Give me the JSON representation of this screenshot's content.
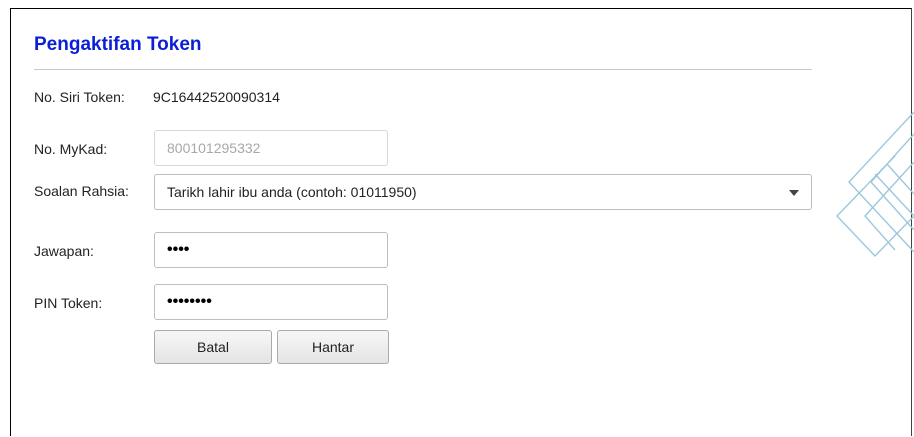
{
  "form": {
    "title": "Pengaktifan Token",
    "serial_label": "No. Siri Token:",
    "serial_value": "9C16442520090314",
    "mykad_label": "No. MyKad:",
    "mykad_value": "800101295332",
    "question_label": "Soalan Rahsia:",
    "question_value": "Tarikh lahir ibu anda (contoh: 01011950)",
    "answer_label": "Jawapan:",
    "answer_value": "••••",
    "pin_label": "PIN Token:",
    "pin_value": "••••••••",
    "cancel_label": "Batal",
    "submit_label": "Hantar"
  },
  "icons": {
    "dropdown": "chevron-down-icon",
    "decoration": "diamond-pattern-icon"
  },
  "colors": {
    "title": "#0a1fd6",
    "decoration": "#9cc7dc"
  }
}
